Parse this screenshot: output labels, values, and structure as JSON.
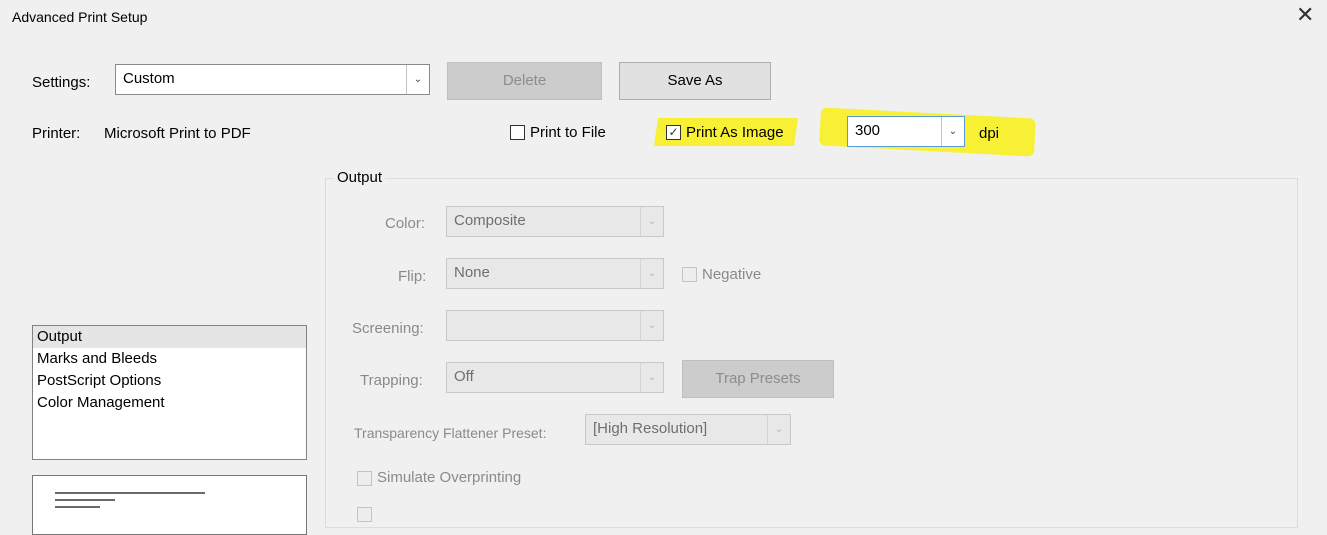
{
  "window": {
    "title": "Advanced Print Setup",
    "close_glyph": "✕"
  },
  "settings": {
    "label": "Settings:",
    "value": "Custom",
    "delete_label": "Delete",
    "save_as_label": "Save As"
  },
  "printer": {
    "label": "Printer:",
    "name": "Microsoft Print to PDF",
    "print_to_file_label": "Print to File",
    "print_to_file_checked": false,
    "print_as_image_label": "Print As Image",
    "print_as_image_checked": true,
    "dpi_value": "300",
    "dpi_unit": "dpi",
    "highlight_color": "#f7ef2a"
  },
  "sidebar": {
    "items": [
      {
        "label": "Output",
        "selected": true
      },
      {
        "label": "Marks and Bleeds",
        "selected": false
      },
      {
        "label": "PostScript Options",
        "selected": false
      },
      {
        "label": "Color Management",
        "selected": false
      }
    ]
  },
  "output": {
    "group_label": "Output",
    "color_label": "Color:",
    "color_value": "Composite",
    "flip_label": "Flip:",
    "flip_value": "None",
    "negative_label": "Negative",
    "screening_label": "Screening:",
    "screening_value": "",
    "trapping_label": "Trapping:",
    "trapping_value": "Off",
    "trap_presets_label": "Trap Presets",
    "flattener_label": "Transparency Flattener Preset:",
    "flattener_value": "[High Resolution]",
    "simulate_overprinting_label": "Simulate Overprinting"
  },
  "icons": {
    "dropdown": "chevron-down-icon",
    "check": "check-icon",
    "close": "close-icon"
  }
}
